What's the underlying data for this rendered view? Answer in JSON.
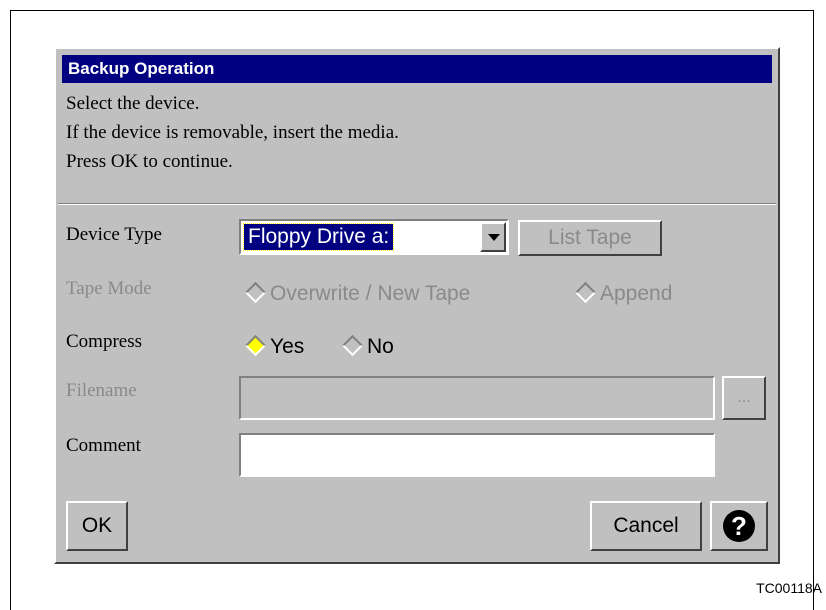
{
  "dialog": {
    "title": "Backup Operation",
    "instructions": [
      "Select the device.",
      "If the device is removable, insert the media.",
      "Press OK to continue."
    ]
  },
  "device_type": {
    "label": "Device Type",
    "selected": "Floppy Drive a:",
    "list_tape_label": "List Tape"
  },
  "tape_mode": {
    "label": "Tape Mode",
    "options": [
      "Overwrite / New Tape",
      "Append"
    ]
  },
  "compress": {
    "label": "Compress",
    "options": [
      "Yes",
      "No"
    ],
    "selected": "Yes"
  },
  "filename": {
    "label": "Filename",
    "value": "",
    "browse_label": "..."
  },
  "comment": {
    "label": "Comment",
    "value": ""
  },
  "buttons": {
    "ok": "OK",
    "cancel": "Cancel",
    "help": "?"
  },
  "figure_code": "TC00118A",
  "colors": {
    "titlebar": "#000080",
    "dialog_bg": "#c0c0c0",
    "radio_checked": "#ffff00"
  }
}
